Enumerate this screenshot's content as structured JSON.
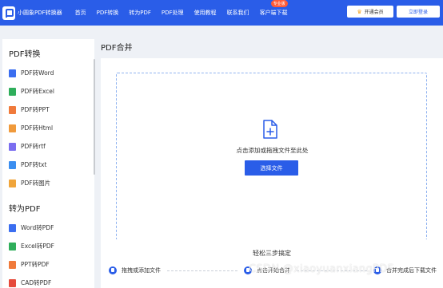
{
  "header": {
    "logo_text": "小圆象PDF转换器",
    "nav": [
      {
        "label": "首页"
      },
      {
        "label": "PDF转换"
      },
      {
        "label": "转为PDF"
      },
      {
        "label": "PDF处理"
      },
      {
        "label": "使用教程"
      },
      {
        "label": "联系我们"
      },
      {
        "label": "客户端下载",
        "badge": "专业版"
      }
    ],
    "vip_button": "开通会员",
    "login_button": "立即登录"
  },
  "sidebar": {
    "group1_title": "PDF转换",
    "group1_items": [
      {
        "label": "PDF转Word",
        "color": "#3b6ef0",
        "accent": "#1e90ff"
      },
      {
        "label": "PDF转Excel",
        "color": "#2fae5b",
        "accent": "#1c8a44"
      },
      {
        "label": "PDF转PPT",
        "color": "#f07a3b",
        "accent": "#e65a12"
      },
      {
        "label": "PDF转Html",
        "color": "#f09a3b",
        "accent": "#e07a12"
      },
      {
        "label": "PDF转rtf",
        "color": "#7b6ef0",
        "accent": "#5a4ee0"
      },
      {
        "label": "PDF转txt",
        "color": "#3b8ef0",
        "accent": "#1e6ee0"
      },
      {
        "label": "PDF转图片",
        "color": "#f0a53b",
        "accent": "#e08a12"
      }
    ],
    "group2_title": "转为PDF",
    "group2_items": [
      {
        "label": "Word转PDF",
        "color": "#3b6ef0",
        "accent": "#e64a3b"
      },
      {
        "label": "Excel转PDF",
        "color": "#2fae5b",
        "accent": "#e64a3b"
      },
      {
        "label": "PPT转PDF",
        "color": "#f07a3b",
        "accent": "#e64a3b"
      },
      {
        "label": "CAD转PDF",
        "color": "#e64a3b",
        "accent": "#c62a1b"
      }
    ]
  },
  "main": {
    "title": "PDF合并",
    "drop_hint": "点击添加或拖拽文件至此处",
    "select_button": "选择文件",
    "steps_title": "轻松三步搞定",
    "steps": [
      {
        "label": "拖拽或添加文件"
      },
      {
        "label": "点击开始合并"
      },
      {
        "label": "合并完成后下载文件"
      }
    ]
  },
  "watermark": "CSDN @xiaoyuanxiangPDF",
  "colors": {
    "brand": "#2a5de8",
    "badge": "#ff5a36",
    "page_bg": "#eef1f6"
  }
}
